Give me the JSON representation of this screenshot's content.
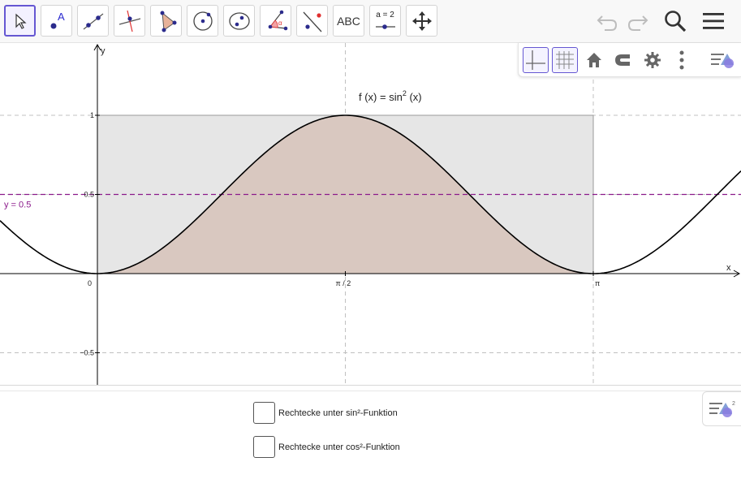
{
  "toolbar": {
    "tools": [
      {
        "id": "move",
        "icon": "arrow-cursor-icon",
        "selected": true
      },
      {
        "id": "point",
        "icon": "point-icon",
        "label": "A"
      },
      {
        "id": "line",
        "icon": "line-through-points-icon"
      },
      {
        "id": "perpendicular",
        "icon": "perpendicular-line-icon"
      },
      {
        "id": "polygon",
        "icon": "polygon-icon"
      },
      {
        "id": "circle",
        "icon": "circle-center-point-icon"
      },
      {
        "id": "ellipse",
        "icon": "ellipse-icon"
      },
      {
        "id": "angle",
        "icon": "angle-icon",
        "label": "α"
      },
      {
        "id": "reflect",
        "icon": "reflect-about-line-icon"
      },
      {
        "id": "text",
        "icon": "text-icon",
        "label": "ABC"
      },
      {
        "id": "slider",
        "icon": "slider-icon",
        "label": "a = 2"
      },
      {
        "id": "move-view",
        "icon": "move-graphics-view-icon"
      }
    ],
    "right_icons": [
      "undo-icon",
      "redo-icon",
      "search-icon",
      "menu-icon"
    ]
  },
  "stylebar": {
    "buttons": [
      "axes-toggle-icon",
      "grid-toggle-icon",
      "home-icon",
      "magnet-icon",
      "settings-gear-icon",
      "more-vertical-icon",
      "algebra-view-icon"
    ],
    "active": [
      "axes-toggle-icon",
      "grid-toggle-icon"
    ]
  },
  "graph": {
    "function_label_left": "f (x)  =  sin",
    "function_label_sup": "2",
    "function_label_right": " (x)",
    "line_label": "y = 0.5",
    "axis_x_label": "x",
    "axis_y_label": "y",
    "tick_x": [
      "0",
      "π / 2",
      "π"
    ],
    "tick_y": [
      "1",
      "0.5",
      "−0.5"
    ],
    "colors": {
      "curve": "#000000",
      "area_fill": "#d9c8c0",
      "rect_fill": "#e6e6e6",
      "line_purple": "#8b1a8b",
      "grid": "#c0c0c0"
    }
  },
  "chart_data": {
    "type": "line",
    "title": "",
    "xlabel": "x",
    "ylabel": "y",
    "xlim": [
      -0.6,
      4.7
    ],
    "ylim": [
      -0.7,
      1.45
    ],
    "grid": true,
    "series": [
      {
        "name": "f (x) = sin² (x)",
        "function": "sin^2(x)"
      },
      {
        "name": "y = 0.5",
        "constant": 0.5
      }
    ],
    "shaded_area": {
      "from": 0,
      "to": 3.14159,
      "under": "f"
    },
    "rectangle": {
      "x": [
        0,
        3.14159
      ],
      "y": [
        0,
        1
      ]
    }
  },
  "bottom": {
    "checkbox_1": "Rechtecke unter sin²-Funktion",
    "checkbox_2": "Rechtecke unter cos²-Funktion"
  }
}
